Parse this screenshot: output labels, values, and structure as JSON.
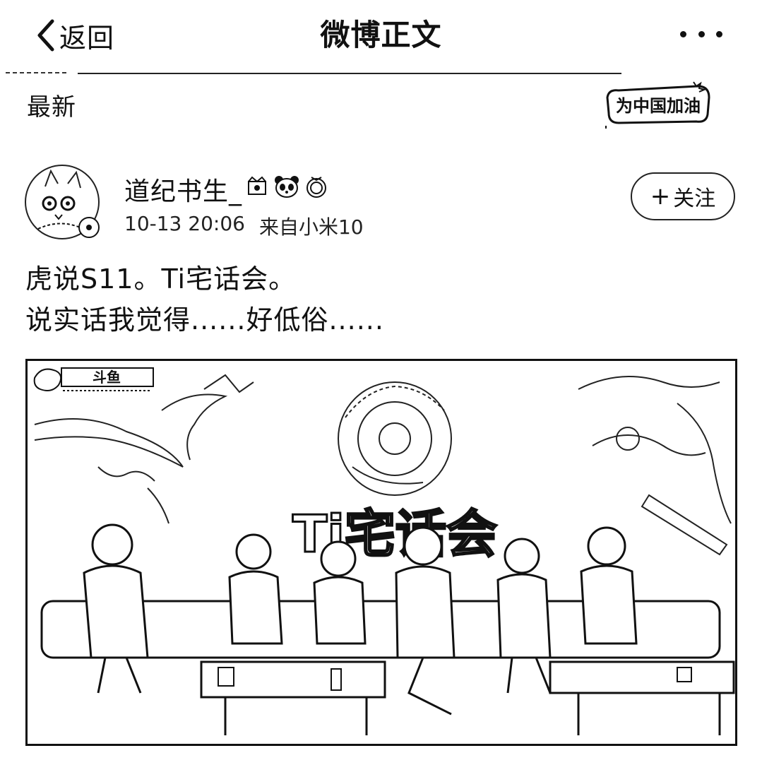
{
  "header": {
    "back_label": "返回",
    "title": "微博正文"
  },
  "subheader": {
    "tab_label": "最新",
    "badge_text": "为中国加油"
  },
  "post": {
    "author": {
      "name": "道纪书生_"
    },
    "timestamp": "10-13 20:06",
    "source": "来自小米10",
    "follow_label": "关注",
    "text_lines": [
      "虎说S11。Ti宅话会。",
      "说实话我觉得......好低俗......"
    ],
    "image": {
      "watermark": "斗鱼",
      "show_title": "Ti宅话会"
    }
  }
}
